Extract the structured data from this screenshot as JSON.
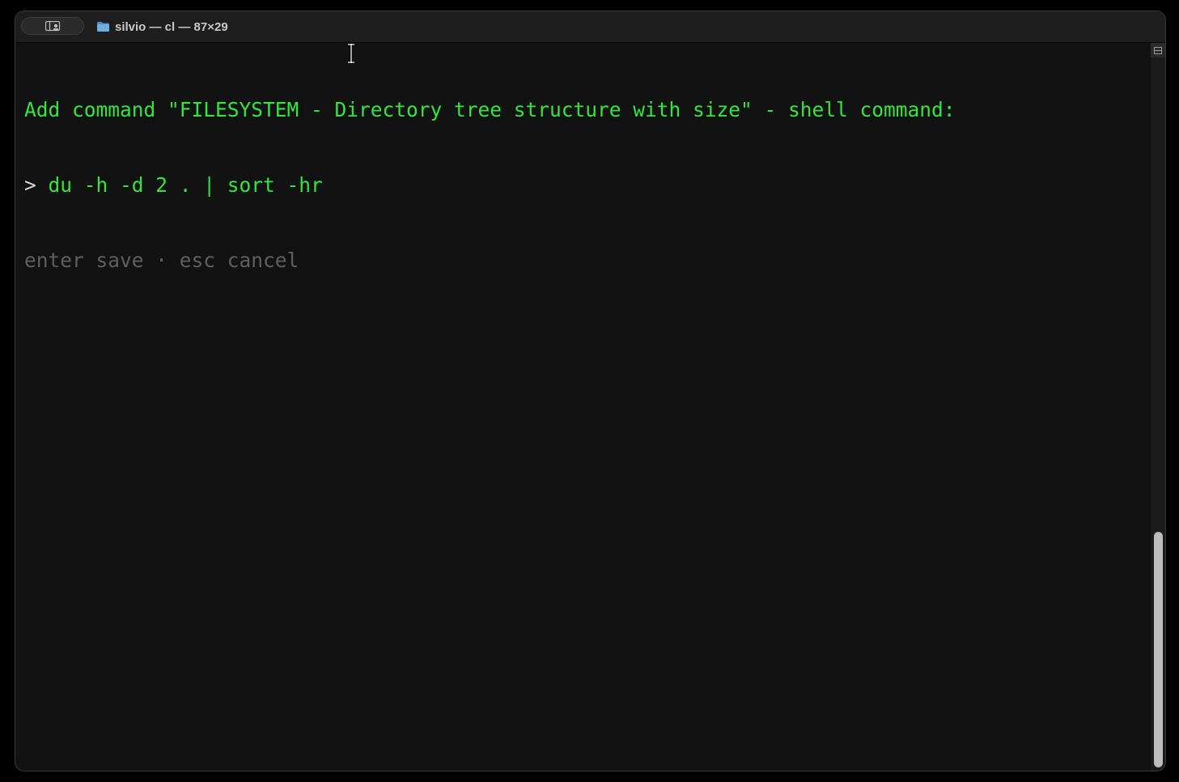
{
  "window": {
    "title": "silvio — cl — 87×29"
  },
  "terminal": {
    "line1": "Add command \"FILESYSTEM - Directory tree structure with size\" - shell command:",
    "prompt_symbol": ">",
    "command_input": " du -h -d 2 . | sort -hr",
    "hint": "enter save · esc cancel"
  },
  "scrollbar": {
    "position_fraction": 1.0,
    "visible_fraction": 0.33
  },
  "colors": {
    "prompt_green": "#35e53f",
    "hint_gray": "#5f5f5f",
    "background": "#121212"
  },
  "icons": [
    "sidebar-toggle-icon",
    "folder-icon",
    "text-cursor-icon",
    "scroll-corner-icon"
  ]
}
